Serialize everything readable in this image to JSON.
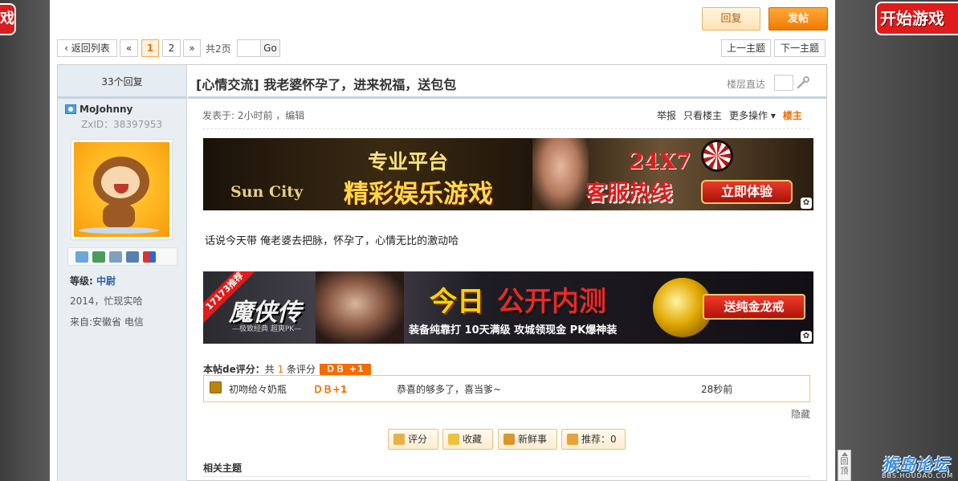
{
  "background": {
    "left_badge": "戏",
    "right_badge": "开始游戏"
  },
  "toolbar": {
    "reply": "回复",
    "post": "发帖"
  },
  "pager": {
    "back": "‹ 返回列表",
    "prev": "«",
    "pages": [
      "1",
      "2"
    ],
    "next": "»",
    "total": "共2页",
    "go": "Go",
    "prev_topic": "上一主题",
    "next_topic": "下一主题"
  },
  "post": {
    "reply_count": "33个回复",
    "title": "[心情交流] 我老婆怀孕了，进来祝福，送包包",
    "jump_label": "楼层直达",
    "meta": "发表于: 2小时前   ，编辑",
    "actions": [
      "举报",
      "只看楼主",
      "更多操作 ▾",
      "楼主"
    ],
    "body": "话说今天带 俺老婆去把脉，怀孕了，心情无比的激动哈"
  },
  "author": {
    "username": "MoJohnny",
    "zxid": "ZxID：38397953",
    "rank_label": "等级:",
    "rank_value": "中尉",
    "line2": "2014，忙现实哈",
    "from": "来自:安徽省 电信",
    "icons": [
      "message-icon",
      "add-friend-icon",
      "profile-icon",
      "card-icon",
      "blocks-icon"
    ]
  },
  "ad1": {
    "logo": "Sun City",
    "line1": "专业平台",
    "line2": "精彩娱乐游戏",
    "hot1": "24X7",
    "hot2": "客服热线",
    "button": "立即体验"
  },
  "ad2": {
    "ribbon": "17173推荐",
    "game": "魔侠传",
    "sub": "—极致经典 超爽PK—",
    "t1": "今日",
    "t2": "公开内测",
    "t3": "装备纯靠打 10天满级 攻城领现金 PK爆神装",
    "button": "送纯金龙戒"
  },
  "rating": {
    "label": "本帖de评分：",
    "prefix": "共",
    "count": "1",
    "suffix": "条评分",
    "badge": "ＤＢ +1",
    "row": {
      "user": "初吻给々奶瓶",
      "score": "ＤＢ+1",
      "reason": "恭喜的够多了，喜当爹~",
      "time": "28秒前"
    },
    "hide": "隐藏"
  },
  "bottom_actions": {
    "rate": "评分",
    "fav": "收藏",
    "new": "新鲜事",
    "recommend": "推荐：0"
  },
  "related": "相关主题",
  "backtop": "回顶",
  "watermark": {
    "name": "猴岛论坛",
    "url": "BBS.HOUDAO.COM"
  }
}
